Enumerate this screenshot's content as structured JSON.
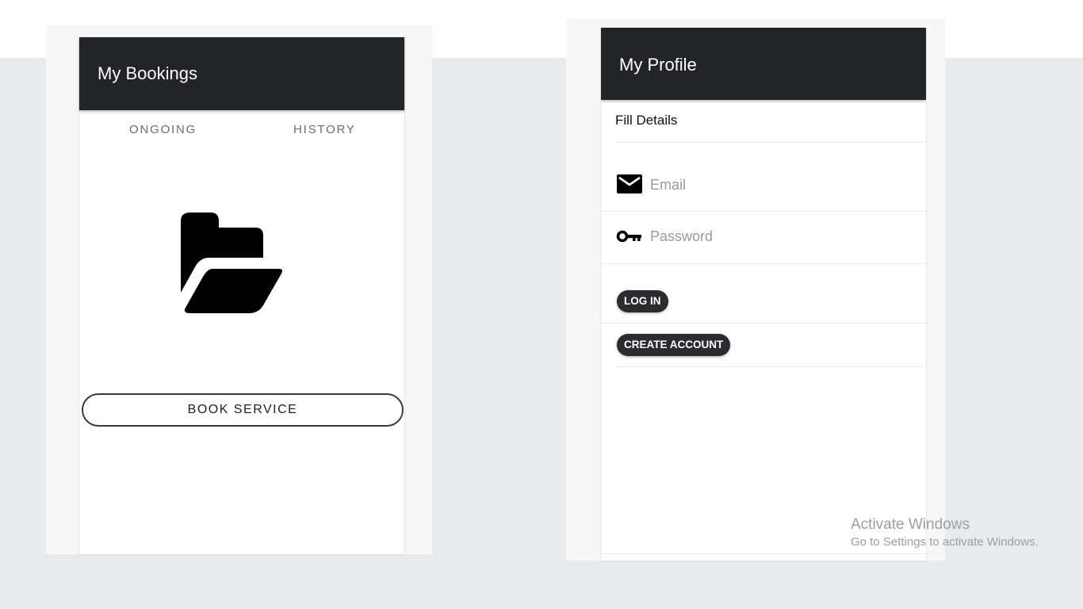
{
  "bookings": {
    "title": "My Bookings",
    "tabs": [
      {
        "label": "ONGOING"
      },
      {
        "label": "HISTORY"
      }
    ],
    "empty_state_icon": "folder-open-icon",
    "book_service_label": "BOOK SERVICE"
  },
  "profile": {
    "title": "My Profile",
    "section_label": "Fill Details",
    "email": {
      "icon": "mail-icon",
      "placeholder": "Email",
      "value": ""
    },
    "password": {
      "icon": "key-icon",
      "placeholder": "Password",
      "value": ""
    },
    "login_label": "LOG IN",
    "create_account_label": "CREATE ACCOUNT"
  },
  "watermark": {
    "line1": "Activate Windows",
    "line2": "Go to Settings to activate Windows."
  },
  "colors": {
    "appbar": "#232427",
    "page_background": "#e7ebeb",
    "button_dark": "#2b2c2f"
  }
}
